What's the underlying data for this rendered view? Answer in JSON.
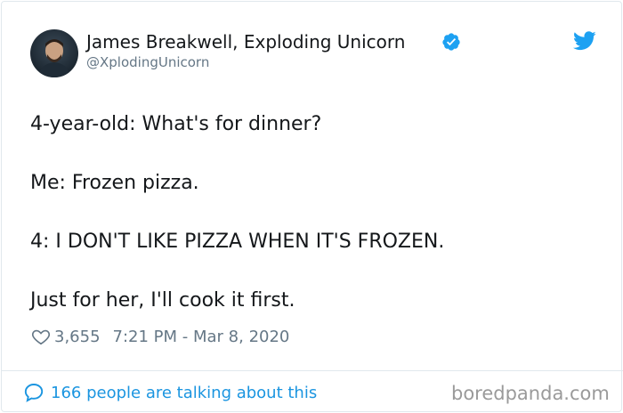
{
  "author": {
    "name": "James Breakwell, Exploding Unicorn",
    "handle": "@XplodingUnicorn",
    "verified": true
  },
  "tweet": {
    "lines": [
      "4-year-old: What's for dinner?",
      "Me: Frozen pizza.",
      "4: I DON'T LIKE PIZZA WHEN IT'S FROZEN.",
      "Just for her, I'll cook it first."
    ]
  },
  "meta": {
    "likes": "3,655",
    "timestamp": "7:21 PM - Mar 8, 2020"
  },
  "footer": {
    "talk_text": "166 people are talking about this",
    "watermark": "boredpanda.com"
  },
  "icons": {
    "verified": "verified-badge-icon",
    "twitter": "twitter-bird-icon",
    "like": "heart-icon",
    "reply": "speech-bubble-icon"
  },
  "colors": {
    "accent": "#1da1f2",
    "link": "#1b95e0",
    "secondary_text": "#657786",
    "primary_text": "#14171a",
    "border": "#e1e8ed"
  }
}
